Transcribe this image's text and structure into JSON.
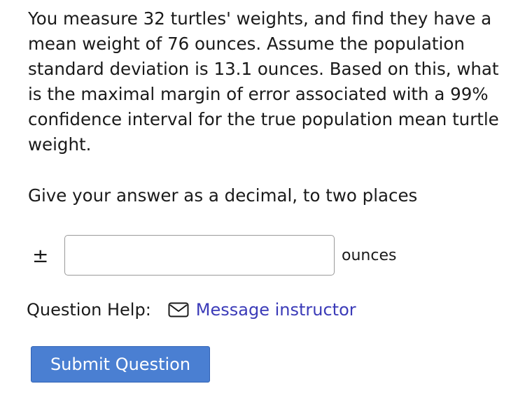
{
  "question": {
    "text": "You measure 32 turtles' weights, and find they have a mean weight of 76 ounces. Assume the population standard deviation is 13.1 ounces. Based on this, what is the maximal margin of error associated with a 99% confidence interval for the true population mean turtle weight.",
    "instruction": "Give your answer as a decimal, to two places"
  },
  "answer": {
    "prefix_symbol": "±",
    "value": "",
    "unit": "ounces"
  },
  "help": {
    "label": "Question Help:",
    "icon": "mail-icon",
    "link_label": "Message instructor"
  },
  "actions": {
    "submit_label": "Submit Question"
  },
  "colors": {
    "link": "#3b3bb8",
    "button_bg": "#4a7fd2",
    "button_text": "#ffffff"
  }
}
